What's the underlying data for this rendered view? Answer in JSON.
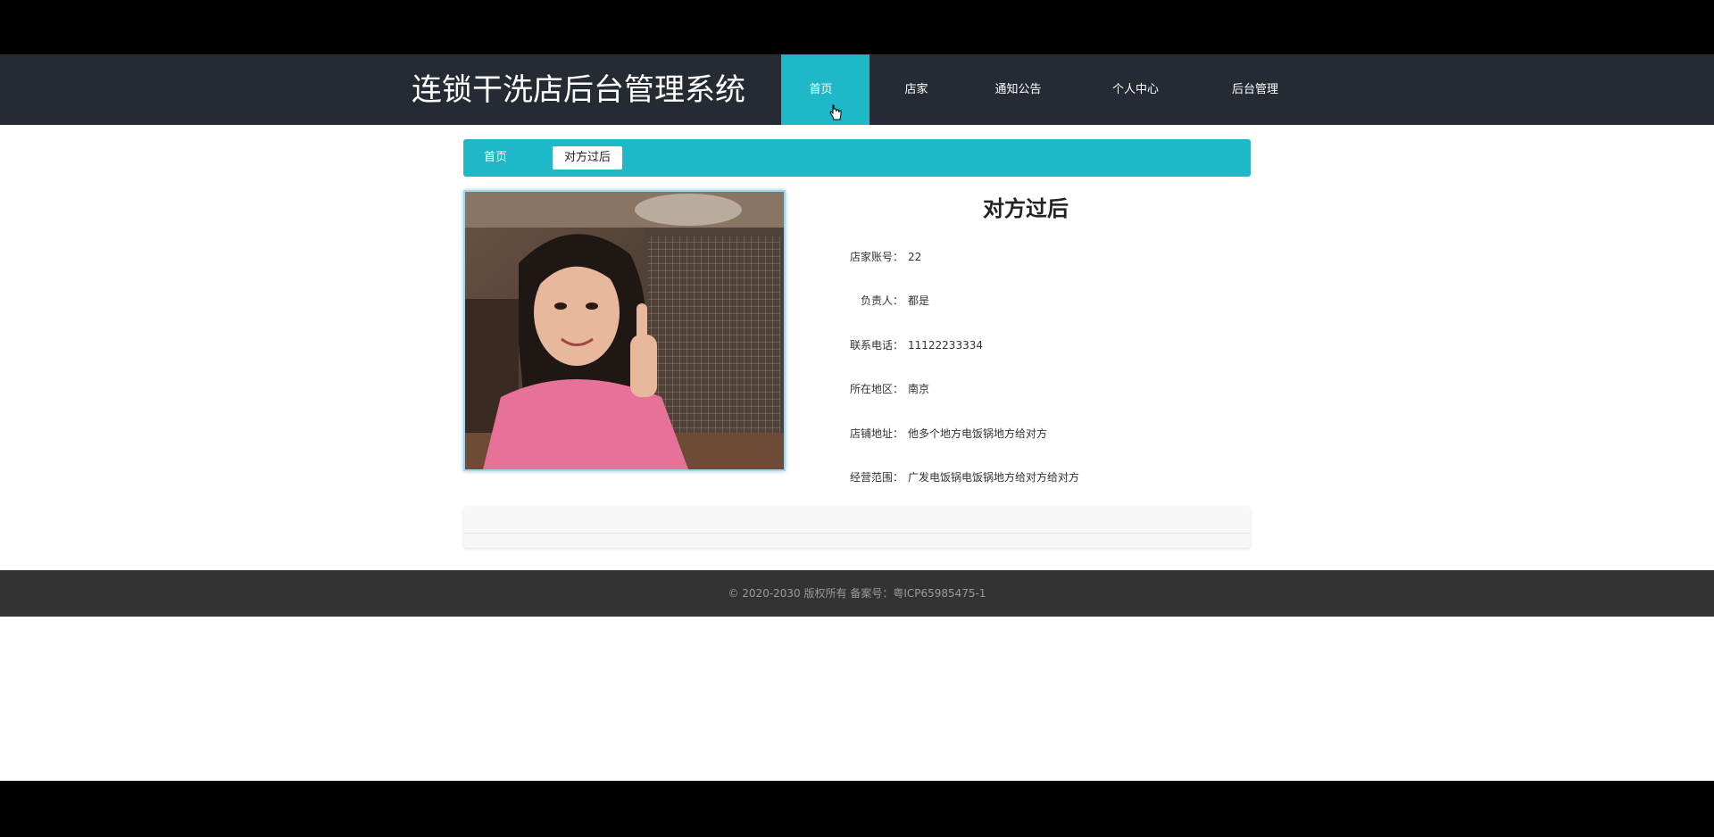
{
  "header": {
    "title": "连锁干洗店后台管理系统",
    "nav": [
      {
        "label": "首页",
        "active": true
      },
      {
        "label": "店家",
        "active": false
      },
      {
        "label": "通知公告",
        "active": false
      },
      {
        "label": "个人中心",
        "active": false
      },
      {
        "label": "后台管理",
        "active": false
      }
    ]
  },
  "breadcrumb": {
    "home": "首页",
    "current": "对方过后"
  },
  "detail": {
    "title": "对方过后",
    "fields": [
      {
        "label": "店家账号：",
        "value": "22"
      },
      {
        "label": "负责人：",
        "value": "都是"
      },
      {
        "label": "联系电话：",
        "value": "11122233334"
      },
      {
        "label": "所在地区：",
        "value": "南京"
      },
      {
        "label": "店铺地址：",
        "value": "他多个地方电饭锅地方给对方"
      },
      {
        "label": "经营范围：",
        "value": "广发电饭锅电饭锅地方给对方给对方"
      }
    ]
  },
  "footer": {
    "copyright": "© 2020-2030 版权所有 备案号：粤ICP65985475-1"
  },
  "colors": {
    "header_bg": "#262a33",
    "accent": "#1fb8c8",
    "footer_bg": "#333333"
  }
}
